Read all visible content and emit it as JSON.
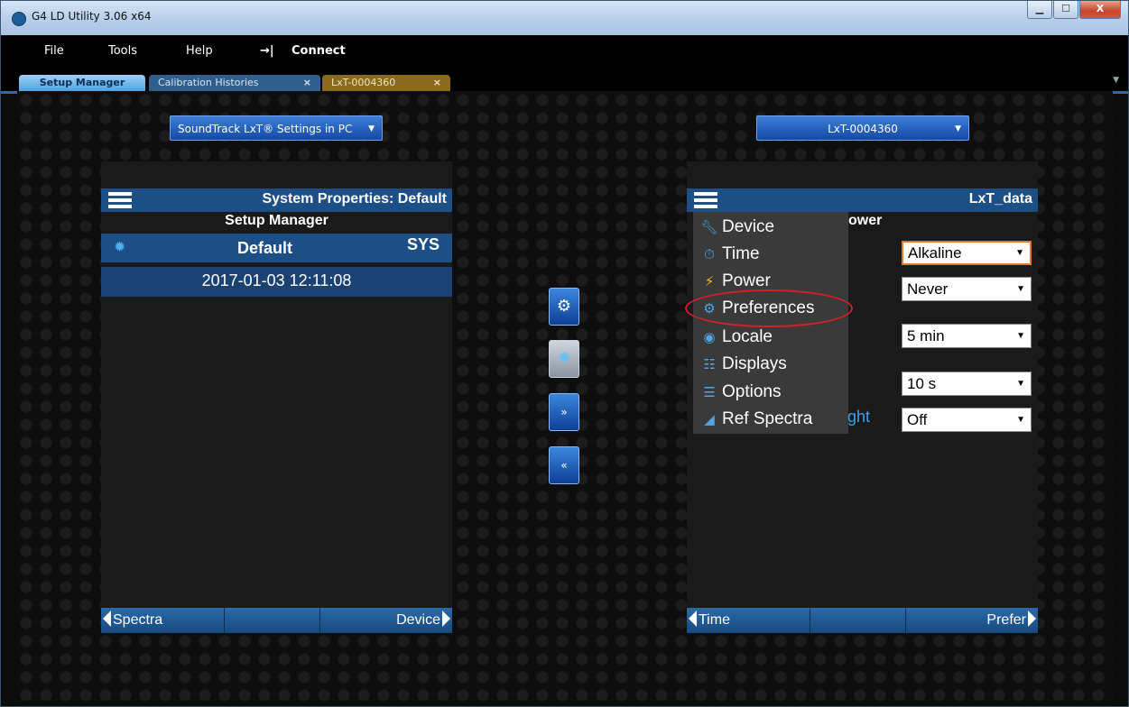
{
  "window": {
    "title": "G4 LD Utility 3.06 x64",
    "controls": {
      "minimize": "▁",
      "maximize": "☐",
      "close": "X"
    }
  },
  "menubar": {
    "file": "File",
    "tools": "Tools",
    "help": "Help",
    "connect_icon": "→|",
    "connect": "Connect"
  },
  "tabs": [
    {
      "label": "Setup Manager",
      "active": true
    },
    {
      "label": "Calibration Histories",
      "close": "×"
    },
    {
      "label": "LxT-0004360",
      "close": "×"
    }
  ],
  "left": {
    "source_dropdown": "SoundTrack LxT® Settings in PC",
    "header_title": "System Properties: Default",
    "subtitle": "Setup Manager",
    "row1_name": "Default",
    "row1_tag": "SYS",
    "row2_timestamp": "2017-01-03 12:11:08",
    "footer_prev": "Spectra",
    "footer_next": "Device"
  },
  "right": {
    "device_dropdown": "LxT-0004360",
    "header_title": "LxT_data",
    "bg_subtitle_fragment": "ower",
    "bg_label_fragment": "ght",
    "selects": {
      "battery": "Alkaline",
      "auto_off": "Never",
      "sleep": "5 min",
      "interval": "10 s",
      "backlight": "Off"
    },
    "footer_prev": "Time",
    "footer_next": "Prefer"
  },
  "nav_menu": {
    "items": [
      {
        "label": "Device",
        "icon": "wrench-icon"
      },
      {
        "label": "Time",
        "icon": "stopwatch-icon"
      },
      {
        "label": "Power",
        "icon": "plug-icon"
      },
      {
        "label": "Preferences",
        "icon": "gear-icon"
      },
      {
        "label": "Locale",
        "icon": "globe-icon"
      },
      {
        "label": "Displays",
        "icon": "displays-icon"
      },
      {
        "label": "Options",
        "icon": "options-icon"
      },
      {
        "label": "Ref Spectra",
        "icon": "spectra-icon"
      }
    ]
  },
  "accent_colors": {
    "panel_header": "#1c4f86",
    "highlight_ellipse": "#d5202a",
    "focus_border": "#e07a2e"
  }
}
